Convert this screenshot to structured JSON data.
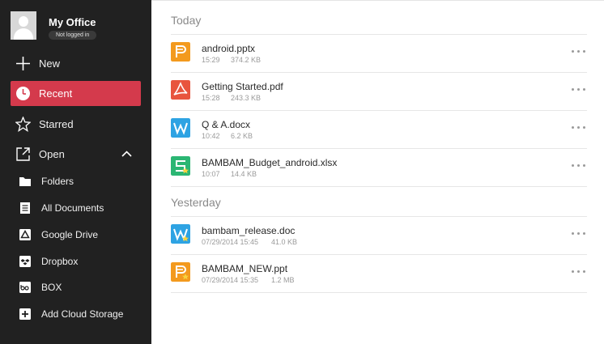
{
  "profile": {
    "name": "My Office",
    "status": "Not logged in"
  },
  "nav": {
    "new": "New",
    "recent": "Recent",
    "starred": "Starred",
    "open": "Open"
  },
  "open_items": [
    {
      "label": "Folders",
      "icon": "folder-icon"
    },
    {
      "label": "All Documents",
      "icon": "documents-icon"
    },
    {
      "label": "Google Drive",
      "icon": "google-drive-icon"
    },
    {
      "label": "Dropbox",
      "icon": "dropbox-icon"
    },
    {
      "label": "BOX",
      "icon": "box-icon"
    },
    {
      "label": "Add Cloud Storage",
      "icon": "add-icon"
    }
  ],
  "sections": {
    "today": {
      "title": "Today",
      "files": [
        {
          "name": "android.pptx",
          "time": "15:29",
          "size": "374.2 KB",
          "type": "presentation"
        },
        {
          "name": "Getting Started.pdf",
          "time": "15:28",
          "size": "243.3 KB",
          "type": "pdf"
        },
        {
          "name": " Q & A.docx",
          "time": "10:42",
          "size": "6.2 KB",
          "type": "document"
        },
        {
          "name": "BAMBAM_Budget_android.xlsx",
          "time": "10:07",
          "size": "14.4 KB",
          "type": "spreadsheet"
        }
      ]
    },
    "yesterday": {
      "title": "Yesterday",
      "files": [
        {
          "name": "bambam_release.doc",
          "time": "07/29/2014 15:45",
          "size": "41.0 KB",
          "type": "document"
        },
        {
          "name": "BAMBAM_NEW.ppt",
          "time": "07/29/2014 15:35",
          "size": "1.2 MB",
          "type": "presentation"
        }
      ]
    }
  },
  "colors": {
    "sidebar_bg": "#212121",
    "active": "#d43a4c",
    "presentation": "#f39a1e",
    "pdf": "#e8553e",
    "document": "#2ea3e3",
    "spreadsheet": "#2bb673"
  }
}
